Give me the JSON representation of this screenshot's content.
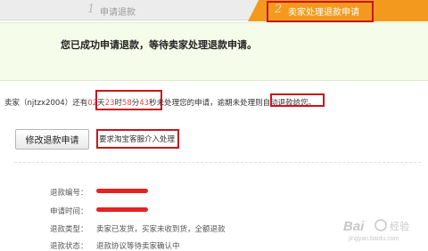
{
  "steps": [
    {
      "number": "1",
      "label": "申请退款"
    },
    {
      "number": "2",
      "label": "卖家处理退款申请"
    }
  ],
  "banner": {
    "message": "您已成功申请退款，等待卖家处理退款申请。"
  },
  "notice": {
    "part1": "卖家（njtzx2004）还有",
    "days": "02",
    "unit_day": "天",
    "hours": "23",
    "unit_hour": "时",
    "minutes": "58",
    "unit_min": "分",
    "seconds": "43",
    "part2": "秒未处理您的申请，逾期未处理则",
    "auto": "自动退款给您。"
  },
  "actions": {
    "modify_button": "修改退款申请",
    "customer_service_link": "要求淘宝客服介入处理"
  },
  "details": [
    {
      "label": "退款编号：",
      "value": ""
    },
    {
      "label": "申请时间：",
      "value": ""
    },
    {
      "label": "退款类型：",
      "value": "卖家已发货，买家未收到货，全额退款"
    },
    {
      "label": "退款状态：",
      "value": "退款协议等待卖家确认中"
    }
  ],
  "watermark": {
    "brand": "Bai",
    "suffix": "经验",
    "sub": "jingyan.baidu.com"
  },
  "colors": {
    "accent": "#f39a1e",
    "annotation": "#c8161d",
    "banner_bg": "#f6fcea",
    "redaction": "#e52222"
  }
}
